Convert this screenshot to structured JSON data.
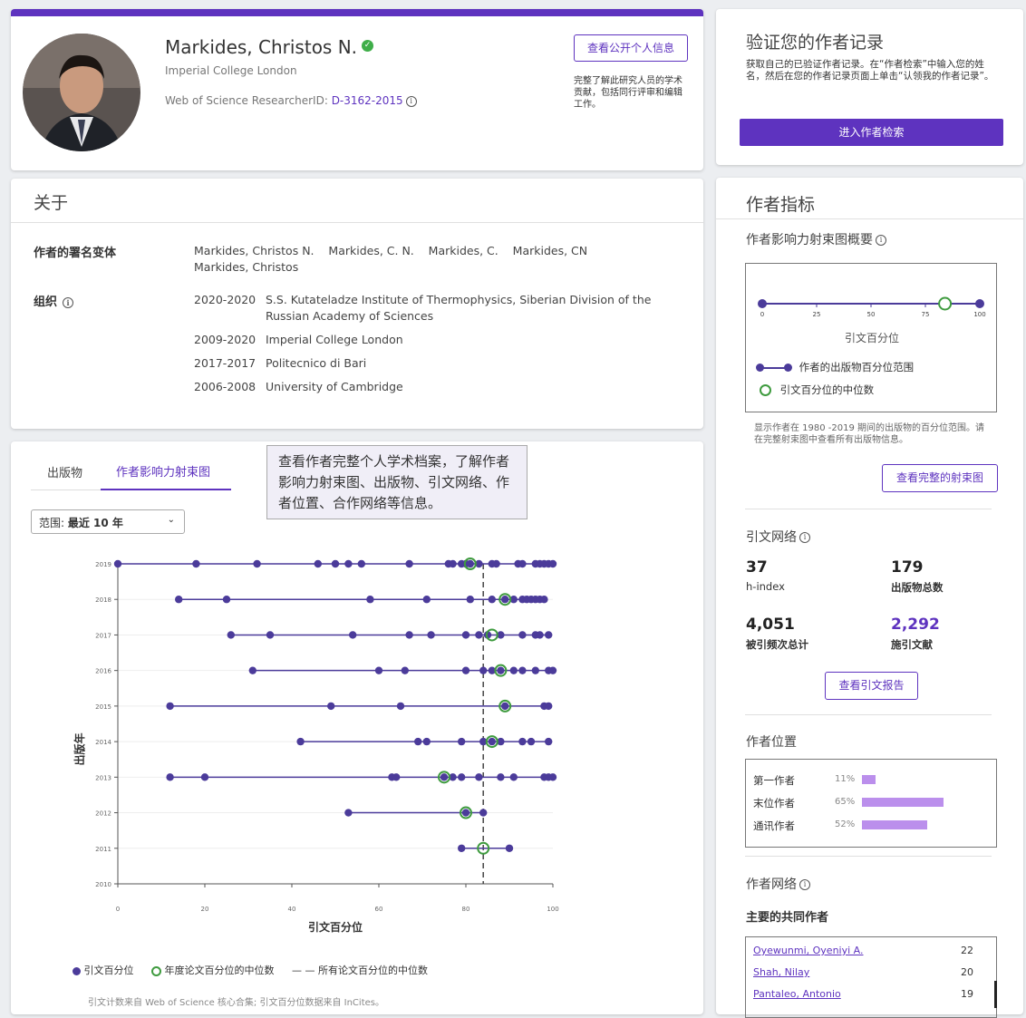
{
  "profile": {
    "name": "Markides, Christos N.",
    "institution": "Imperial College London",
    "researcher_id_label": "Web of Science ResearcherID: ",
    "researcher_id": "D-3162-2015",
    "view_public_button": "查看公开个人信息",
    "view_public_note": "完整了解此研究人员的学术贡献，包括同行评审和编辑工作。"
  },
  "verify": {
    "title": "验证您的作者记录",
    "description": "获取自己的已验证作者记录。在“作者检索”中输入您的姓名，然后在您的作者记录页面上单击“认领我的作者记录”。",
    "button": "进入作者检索"
  },
  "about": {
    "title": "关于",
    "name_variants_label": "作者的署名变体",
    "name_variants": "Markides, Christos N.    Markides, C. N.    Markides, C.    Markides, CN    Markides, Christos",
    "org_label": "组织",
    "orgs": [
      {
        "years": "2020-2020",
        "name": "S.S. Kutateladze Institute of Thermophysics, Siberian Division of the Russian Academy of Sciences"
      },
      {
        "years": "2009-2020",
        "name": "Imperial College London"
      },
      {
        "years": "2017-2017",
        "name": "Politecnico di Bari"
      },
      {
        "years": "2006-2008",
        "name": "University of Cambridge"
      }
    ]
  },
  "tabs": {
    "publications": "出版物",
    "beamplot": "作者影响力射束图"
  },
  "tooltip": "查看作者完整个人学术档案，了解作者影响力射束图、出版物、引文网络、作者位置、合作网络等信息。",
  "range": {
    "label": "范围:",
    "value": "最近 10 年"
  },
  "chart_data": {
    "type": "scatter",
    "xlabel": "引文百分位",
    "ylabel": "出版年",
    "xlim": [
      0,
      100
    ],
    "xticks": [
      "0",
      "20",
      "40",
      "60",
      "80",
      "100"
    ],
    "ylim": [
      2010,
      2019
    ],
    "yticks": [
      "2010",
      "2011",
      "2012",
      "2013",
      "2014",
      "2015",
      "2016",
      "2017",
      "2018",
      "2019"
    ],
    "overall_median": 84,
    "series": [
      {
        "name": "引文百分位",
        "points": [
          {
            "year": 2019,
            "values": [
              0,
              18,
              32,
              46,
              50,
              53,
              56,
              67,
              76,
              77,
              79,
              80,
              81,
              83,
              86,
              87,
              92,
              93,
              96,
              97,
              98,
              99,
              100
            ]
          },
          {
            "year": 2018,
            "values": [
              14,
              25,
              58,
              71,
              81,
              86,
              89,
              91,
              93,
              94,
              95,
              96,
              97,
              98
            ]
          },
          {
            "year": 2017,
            "values": [
              26,
              35,
              54,
              67,
              72,
              80,
              83,
              85,
              88,
              93,
              96,
              97,
              99
            ]
          },
          {
            "year": 2016,
            "values": [
              31,
              60,
              66,
              80,
              84,
              86,
              88,
              91,
              93,
              96,
              99,
              100
            ]
          },
          {
            "year": 2015,
            "values": [
              12,
              49,
              65,
              89,
              98,
              99
            ]
          },
          {
            "year": 2014,
            "values": [
              42,
              69,
              71,
              79,
              84,
              86,
              88,
              93,
              95,
              99
            ]
          },
          {
            "year": 2013,
            "values": [
              12,
              20,
              63,
              64,
              75,
              77,
              79,
              83,
              88,
              91,
              98,
              99,
              100
            ]
          },
          {
            "year": 2012,
            "values": [
              53,
              80,
              84
            ]
          },
          {
            "year": 2011,
            "values": [
              79,
              90
            ]
          }
        ]
      },
      {
        "name": "年度论文百分位的中位数",
        "points": [
          {
            "year": 2019,
            "value": 81
          },
          {
            "year": 2018,
            "value": 89
          },
          {
            "year": 2017,
            "value": 86
          },
          {
            "year": 2016,
            "value": 88
          },
          {
            "year": 2015,
            "value": 89
          },
          {
            "year": 2014,
            "value": 86
          },
          {
            "year": 2013,
            "value": 75
          },
          {
            "year": 2012,
            "value": 80
          },
          {
            "year": 2011,
            "value": 84
          }
        ]
      }
    ],
    "legend": [
      "引文百分位",
      "年度论文百分位的中位数",
      "所有论文百分位的中位数"
    ],
    "footnote": "引文计数来自 Web of Science 核心合集; 引文百分位数据来自 InCites。",
    "colors": {
      "dot": "#4b3b9a",
      "median": "#3f9b3f",
      "line": "#4b3b9a"
    }
  },
  "metrics": {
    "title": "作者指标",
    "summary_title": "作者影响力射束图概要",
    "mini": {
      "ticks": [
        "0",
        "25",
        "50",
        "75",
        "100"
      ],
      "range": [
        0,
        100
      ],
      "median": 84,
      "axis_label": "引文百分位",
      "legend_range": "作者的出版物百分位范围",
      "legend_median": "引文百分位的中位数"
    },
    "summary_note": "显示作者在 1980 -2019 期间的出版物的百分位范围。请在完整射束图中查看所有出版物信息。",
    "view_full_button": "查看完整的射束图",
    "citation_network_title": "引文网络",
    "h_index": "37",
    "h_index_label": "h-index",
    "pubs": "179",
    "pubs_label": "出版物总数",
    "times_cited": "4,051",
    "times_cited_label": "被引频次总计",
    "citing": "2,292",
    "citing_label": "施引文献",
    "report_button": "查看引文报告",
    "position_title": "作者位置",
    "positions": [
      {
        "label": "第一作者",
        "pct": "11%",
        "value": 0.11
      },
      {
        "label": "末位作者",
        "pct": "65%",
        "value": 0.65
      },
      {
        "label": "通讯作者",
        "pct": "52%",
        "value": 0.52
      }
    ],
    "network_title": "作者网络",
    "coauthors_title": "主要的共同作者",
    "coauthors": [
      {
        "name": "Oyewunmi, Oyeniyi A.",
        "count": "22"
      },
      {
        "name": "Shah, Nilay",
        "count": "20"
      },
      {
        "name": "Pantaleo, Antonio",
        "count": "19"
      }
    ]
  }
}
